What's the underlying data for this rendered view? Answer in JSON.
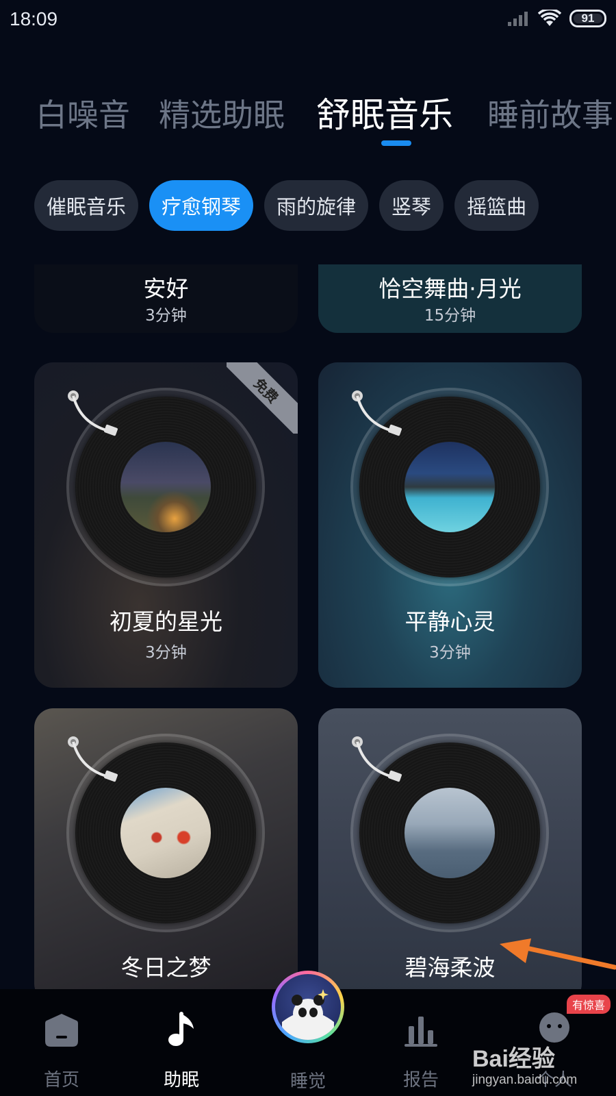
{
  "status_bar": {
    "time": "18:09",
    "battery": "91"
  },
  "top_tabs": [
    {
      "label": "白噪音"
    },
    {
      "label": "精选助眠"
    },
    {
      "label": "舒眠音乐",
      "active": true
    },
    {
      "label": "睡前故事"
    }
  ],
  "chips": [
    {
      "label": "催眠音乐"
    },
    {
      "label": "疗愈钢琴",
      "active": true
    },
    {
      "label": "雨的旋律"
    },
    {
      "label": "竖琴"
    },
    {
      "label": "摇篮曲"
    }
  ],
  "cards": [
    {
      "title": "安好",
      "duration": "3分钟"
    },
    {
      "title": "恰空舞曲·月光",
      "duration": "15分钟"
    },
    {
      "title": "初夏的星光",
      "duration": "3分钟",
      "tag": "免费"
    },
    {
      "title": "平静心灵",
      "duration": "3分钟"
    },
    {
      "title": "冬日之梦"
    },
    {
      "title": "碧海柔波"
    }
  ],
  "bottom_nav": [
    {
      "label": "首页",
      "icon": "home-icon"
    },
    {
      "label": "助眠",
      "icon": "music-note-icon",
      "active": true
    },
    {
      "label": "睡觉",
      "icon": "panda-moon-icon"
    },
    {
      "label": "报告",
      "icon": "bar-chart-icon"
    },
    {
      "label": "个人",
      "icon": "profile-icon",
      "badge": "有惊喜"
    }
  ],
  "watermark": {
    "brand": "Bai经验",
    "url": "jingyan.baidu.com"
  },
  "colors": {
    "accent": "#1a90f5",
    "background": "#050a17",
    "annotation_arrow": "#f07a2a"
  }
}
